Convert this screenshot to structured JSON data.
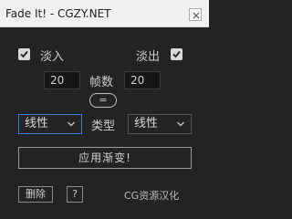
{
  "window": {
    "title": "Fade It! - CGZY.NET"
  },
  "fade_in": {
    "label": "淡入",
    "checked": true,
    "value": "20"
  },
  "fade_out": {
    "label": "淡出",
    "checked": true,
    "value": "20"
  },
  "frames_label": "帧数",
  "equal_button": {
    "label": "="
  },
  "type_label": "类型",
  "fade_in_type": {
    "selected": "线性"
  },
  "fade_out_type": {
    "selected": "线性"
  },
  "apply_button": {
    "label": "应用渐变!"
  },
  "delete_button": {
    "label": "删除"
  },
  "help_button": {
    "label": "?"
  },
  "credit": "CG资源汉化",
  "colors": {
    "background": "#232323",
    "focus_border": "#3f7fd6",
    "checkbox": "#d9d9d9"
  }
}
